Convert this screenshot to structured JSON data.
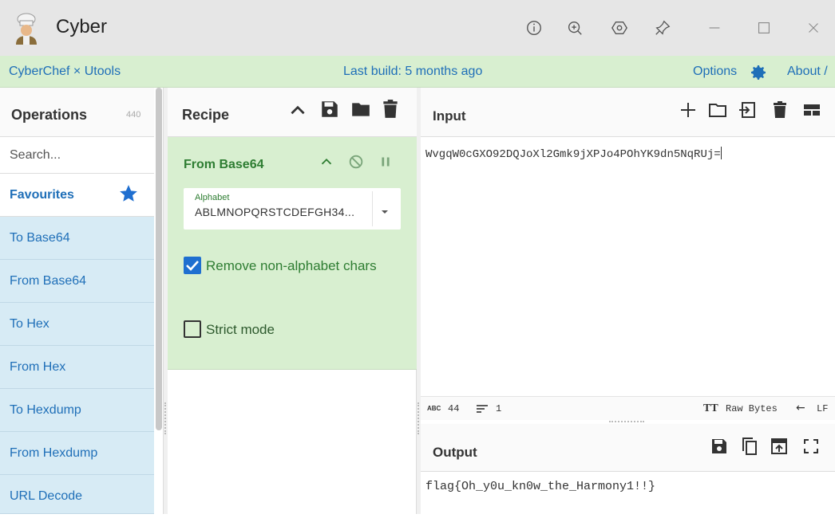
{
  "window": {
    "title": "Cyber",
    "controls": [
      "info-icon",
      "zoom-in-icon",
      "settings-hex-icon",
      "pin-icon",
      "minimize-icon",
      "maximize-icon",
      "close-icon"
    ]
  },
  "nav": {
    "brand": "CyberChef × Utools",
    "build": "Last build: 5 months ago",
    "options": "Options",
    "about": "About /"
  },
  "operations": {
    "title": "Operations",
    "count": "440",
    "search_placeholder": "Search...",
    "favourites": "Favourites",
    "items": [
      "To Base64",
      "From Base64",
      "To Hex",
      "From Hex",
      "To Hexdump",
      "From Hexdump",
      "URL Decode"
    ]
  },
  "recipe": {
    "title": "Recipe",
    "operation": {
      "name": "From Base64",
      "alphabet_label": "Alphabet",
      "alphabet_value": "ABLMNOPQRSTCDEFGH34...",
      "remove_non_alpha": "Remove non-alphabet chars",
      "remove_non_alpha_checked": true,
      "strict_mode": "Strict mode",
      "strict_mode_checked": false
    }
  },
  "input": {
    "title": "Input",
    "text": "WvgqW0cGXO92DQJoXl2Gmk9jXPJo4POhYK9dn5NqRUj="
  },
  "status": {
    "abc": "ABC",
    "length": "44",
    "lines": "1",
    "tt": "TT",
    "encoding": "Raw Bytes",
    "eol_arrow": "←",
    "eol": "LF"
  },
  "output": {
    "title": "Output",
    "text": "flag{Oh_y0u_kn0w_the_Harmony1!!}"
  },
  "colors": {
    "accent_blue": "#1f6fb8",
    "recipe_green": "#d8efd0",
    "ops_blue": "#d7ebf5",
    "checkbox_blue": "#1f6fd0"
  }
}
